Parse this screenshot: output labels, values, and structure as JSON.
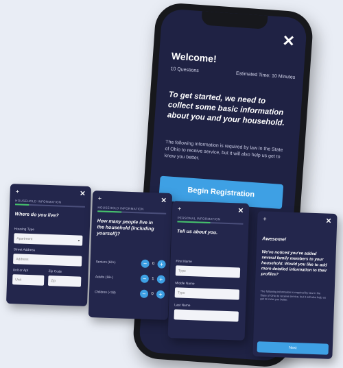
{
  "phone": {
    "welcome_title": "Welcome!",
    "question_count": "10 Questions",
    "estimated_time": "Estimated Time: 10 Minutes",
    "lead_text": "To get started, we need to collect some basic information about you and your household.",
    "fine_print": "The following information is required by law in the State of Ohio to receive service, but it will also help us get to know you better.",
    "begin_button": "Begin Registration"
  },
  "card1": {
    "section": "HOUSEHOLD INFORMATION",
    "progress": 0.2,
    "question": "Where do you live?",
    "housing_label": "Housing Type",
    "housing_value": "Apartment",
    "street_label": "Street Address",
    "street_placeholder": "Address",
    "unit_label": "Unit or Apt",
    "unit_placeholder": "Unit",
    "zip_label": "Zip Code",
    "zip_placeholder": "Zip"
  },
  "card2": {
    "section": "HOUSEHOLD INFORMATION",
    "progress": 0.35,
    "question": "How many people live in the household (including yourself)?",
    "rows": [
      {
        "label": "Seniors (60+)",
        "value": "0"
      },
      {
        "label": "Adults (18+)",
        "value": "1"
      },
      {
        "label": "Children (<18)",
        "value": "0"
      }
    ]
  },
  "card3": {
    "section": "PERSONAL INFORMATION",
    "progress": 0.5,
    "question": "Tell us about you.",
    "first_label": "First Name",
    "first_placeholder": "Type",
    "middle_label": "Middle Name",
    "middle_placeholder": "Type",
    "last_label": "Last Name"
  },
  "card4": {
    "title": "Awesome!",
    "message": "We've noticed you've added several family members to your household. Would you like to add more detailed information to their profiles?",
    "fine_print": "The following information is required by law in the State of Ohio to receive service, but it will also help us get to know you better.",
    "next_button": "Next"
  },
  "colors": {
    "navy": "#23264c",
    "accent": "#3ea0e4",
    "progress": "#45c26b"
  },
  "icons": [
    "close-icon",
    "plus-icon",
    "minus-icon"
  ]
}
